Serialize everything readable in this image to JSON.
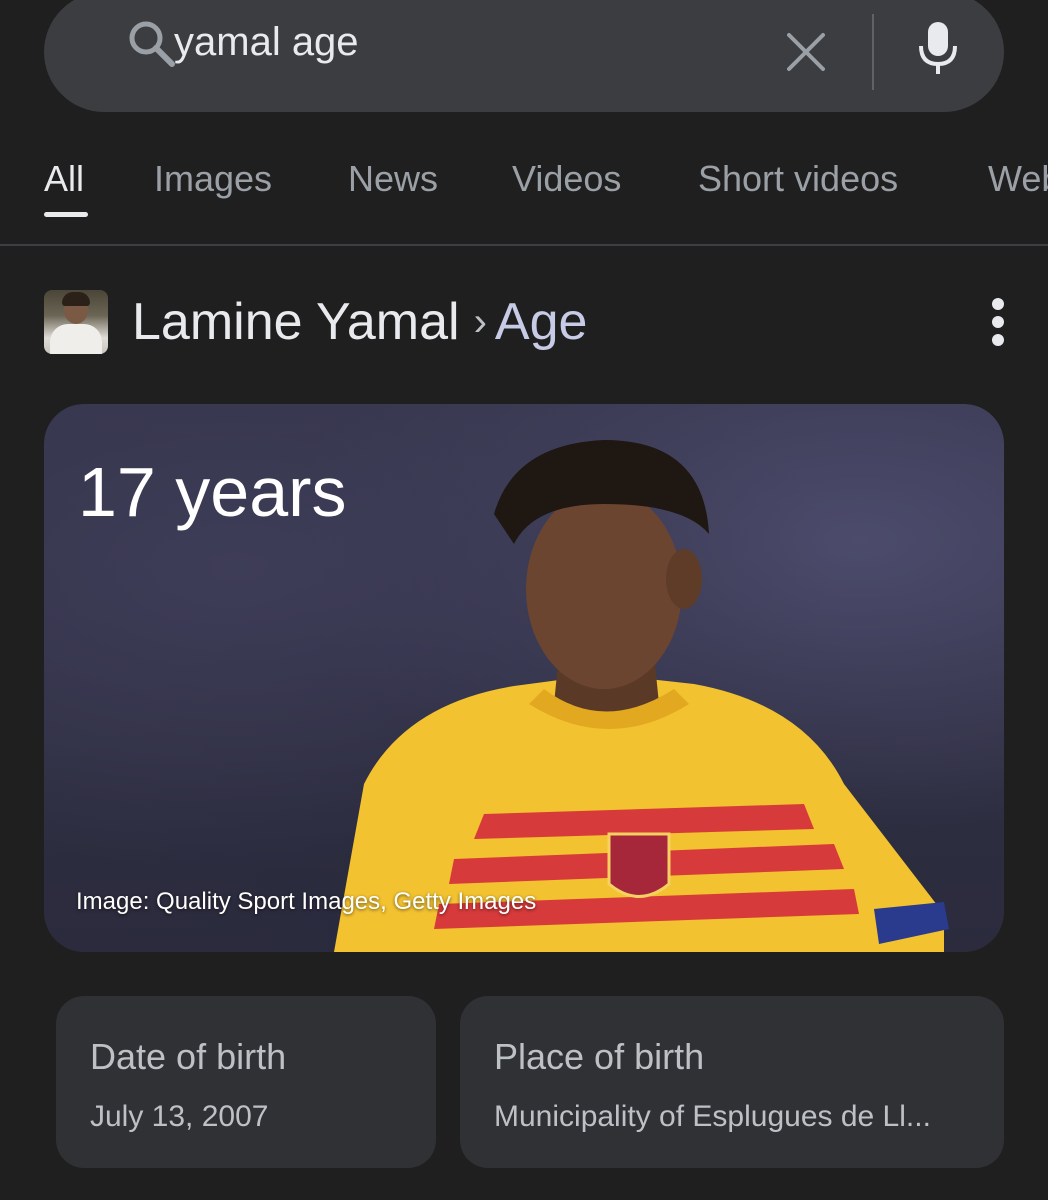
{
  "search": {
    "query": "yamal age",
    "icons": [
      "search-icon",
      "clear-icon",
      "mic-icon"
    ]
  },
  "tabs": [
    {
      "label": "All",
      "active": true
    },
    {
      "label": "Images"
    },
    {
      "label": "News"
    },
    {
      "label": "Videos"
    },
    {
      "label": "Short videos"
    },
    {
      "label": "Web"
    }
  ],
  "entity": {
    "name": "Lamine Yamal",
    "separator": "›",
    "attribute": "Age"
  },
  "hero": {
    "age": "17 years",
    "credit": "Image: Quality Sport Images, Getty Images"
  },
  "cards": [
    {
      "label": "Date of birth",
      "value": "July 13, 2007"
    },
    {
      "label": "Place of birth",
      "value": "Municipality of Esplugues de Ll..."
    }
  ],
  "colors": {
    "background": "#1f1f1f",
    "surface": "#303134",
    "search_bg": "#3c3d40",
    "text_primary": "#e8eaed",
    "text_secondary": "#9aa0a6",
    "accent_attr": "#c8cbe6"
  }
}
